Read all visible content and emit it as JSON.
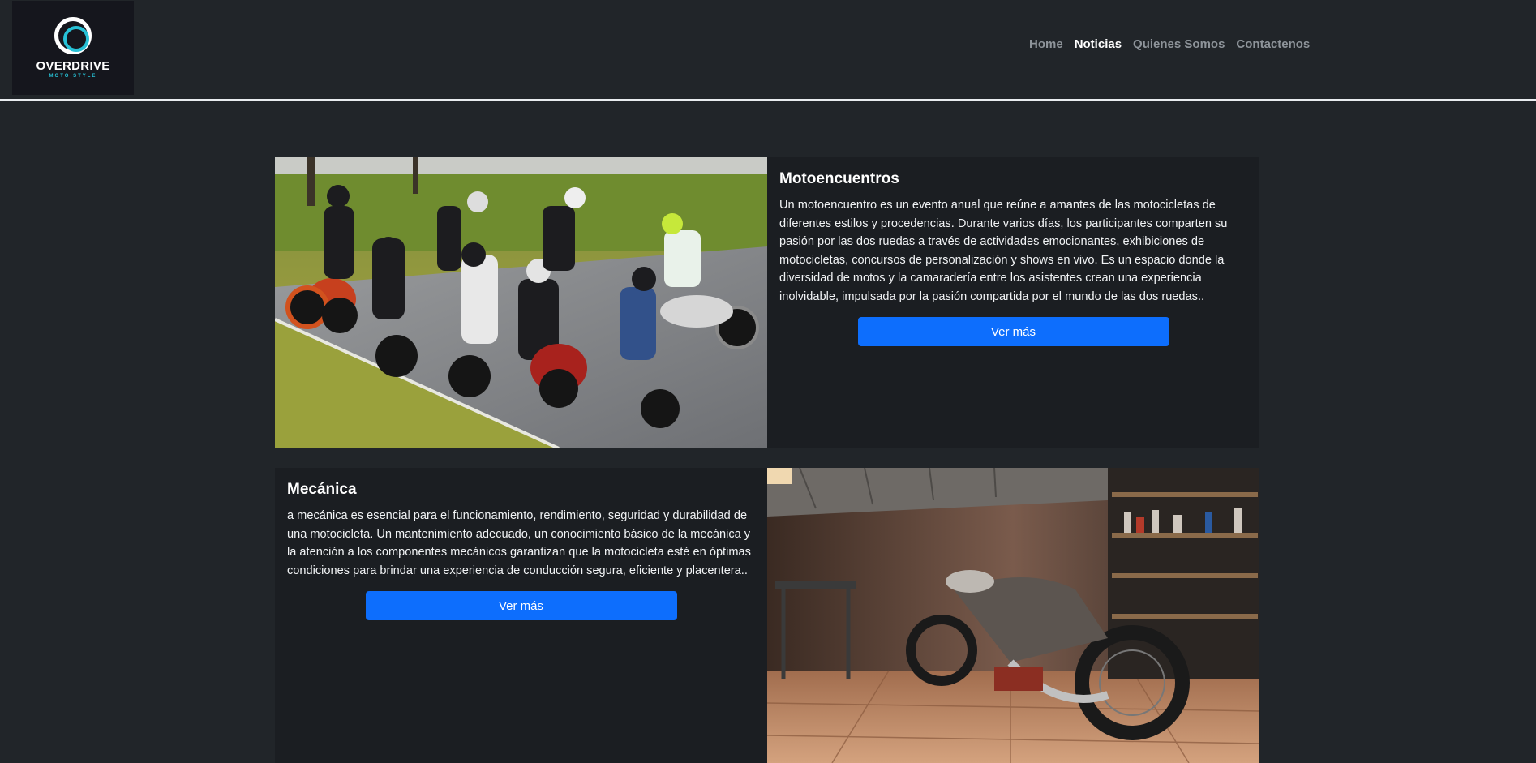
{
  "brand": {
    "name": "OVERDRIVE",
    "tagline": "MOTO STYLE"
  },
  "nav": {
    "items": [
      {
        "label": "Home",
        "active": false
      },
      {
        "label": "Noticias",
        "active": true
      },
      {
        "label": "Quienes Somos",
        "active": false
      },
      {
        "label": "Contactenos",
        "active": false
      }
    ]
  },
  "cards": [
    {
      "title": "Motoencuentros",
      "text": "Un motoencuentro es un evento anual que reúne a amantes de las motocicletas de diferentes estilos y procedencias. Durante varios días, los participantes comparten su pasión por las dos ruedas a través de actividades emocionantes, exhibiciones de motocicletas, concursos de personalización y shows en vivo. Es un espacio donde la diversidad de motos y la camaradería entre los asistentes crean una experiencia inolvidable, impulsada por la pasión compartida por el mundo de las dos ruedas..",
      "button": "Ver más"
    },
    {
      "title": "Mecánica",
      "text": "a mecánica es esencial para el funcionamiento, rendimiento, seguridad y durabilidad de una motocicleta. Un mantenimiento adecuado, un conocimiento básico de la mecánica y la atención a los componentes mecánicos garantizan que la motocicleta esté en óptimas condiciones para brindar una experiencia de conducción segura, eficiente y placentera..",
      "button": "Ver más"
    }
  ],
  "colors": {
    "background": "#212529",
    "card": "#1b1e22",
    "button": "#0d6efd",
    "accent": "#27c1d6"
  }
}
